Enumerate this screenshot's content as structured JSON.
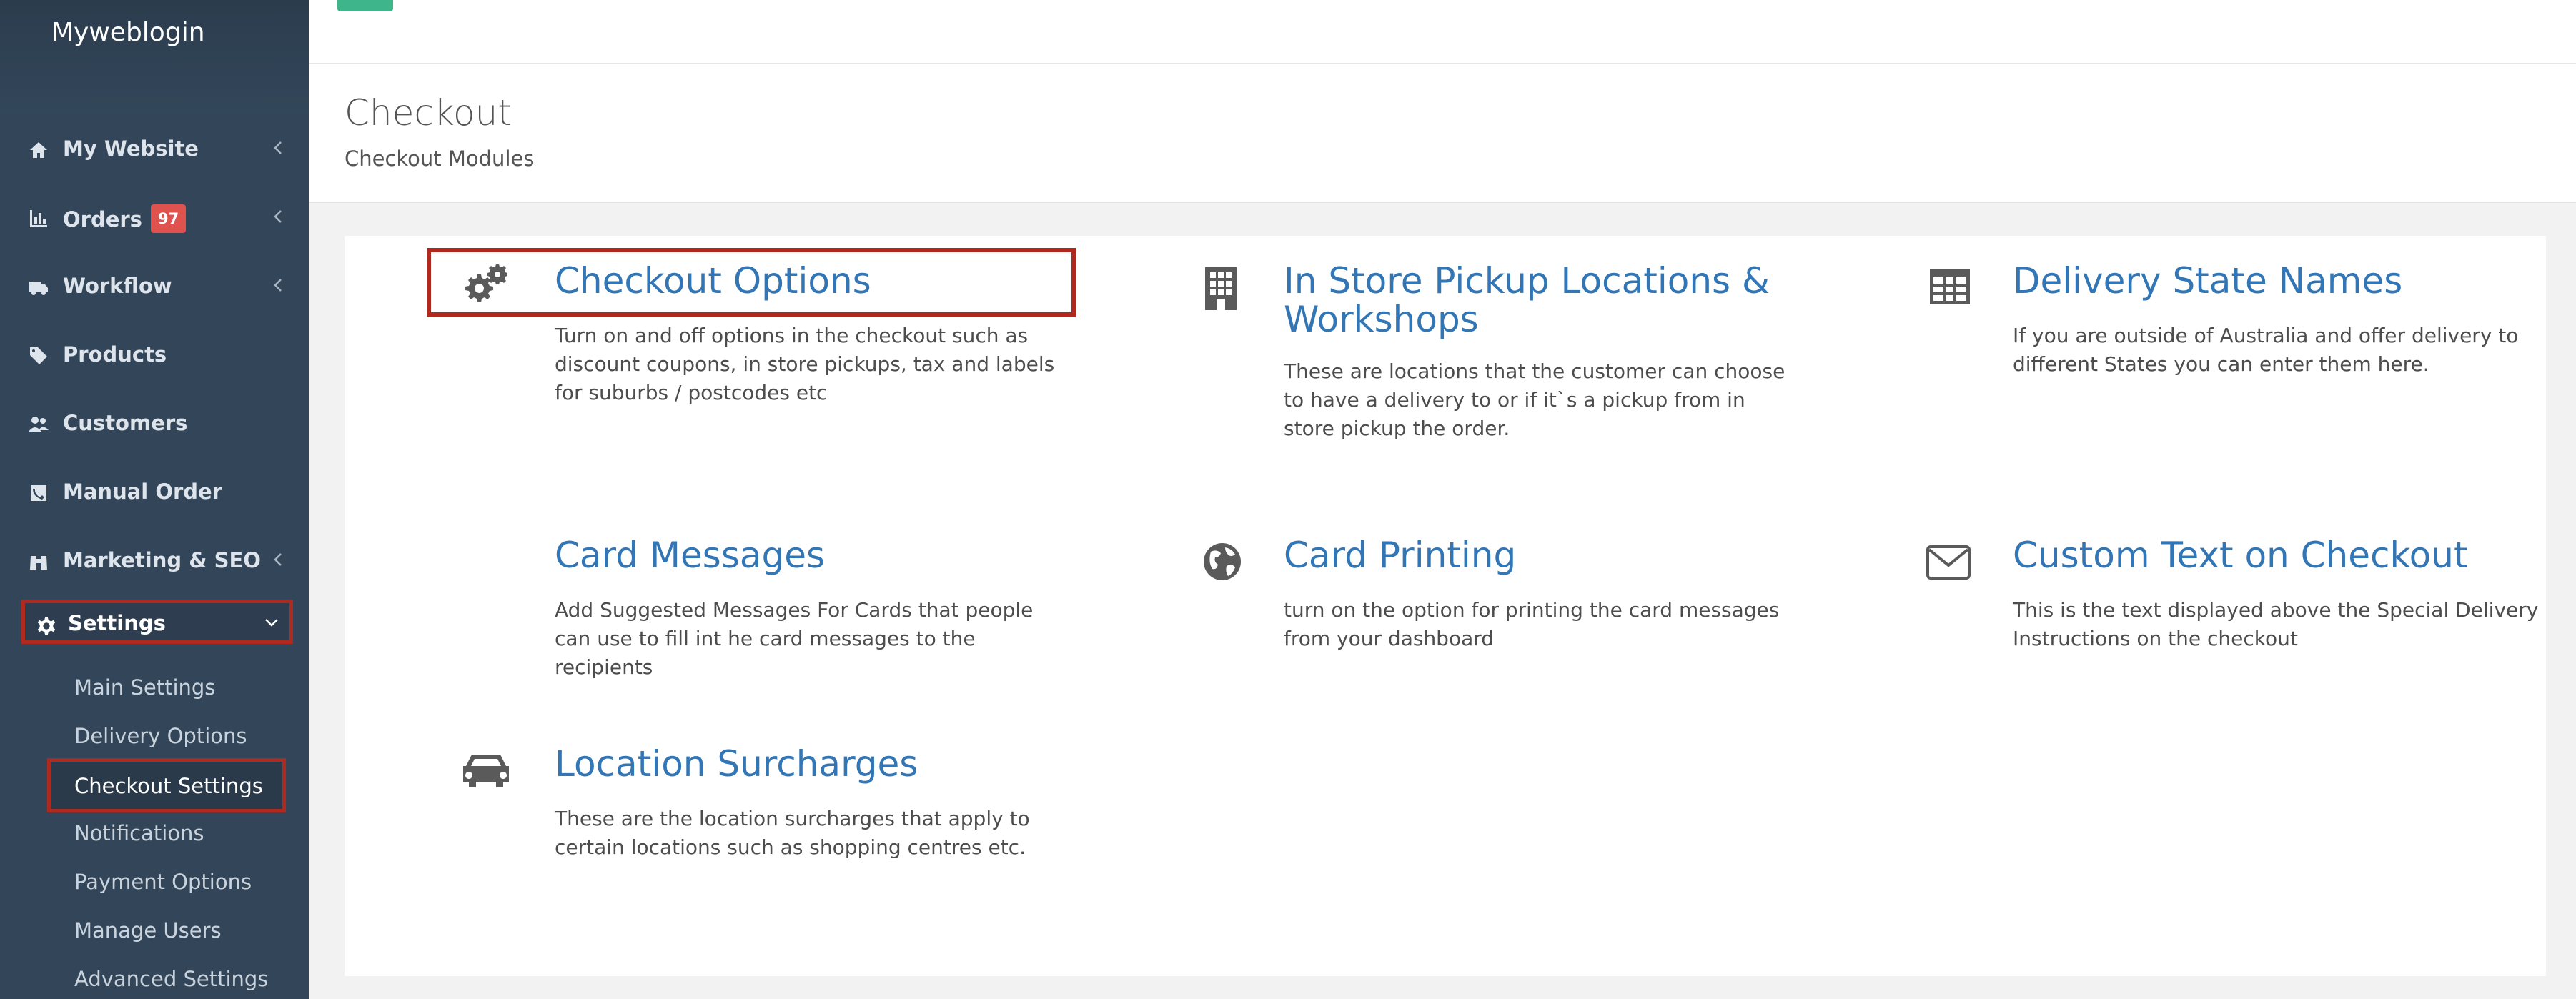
{
  "sidebar": {
    "brand": "Myweblogin",
    "items": [
      {
        "label": "My Website",
        "icon": "home-icon"
      },
      {
        "label": "Orders",
        "icon": "bar-chart-icon",
        "badge": "97"
      },
      {
        "label": "Workflow",
        "icon": "truck-icon"
      },
      {
        "label": "Products",
        "icon": "tags-icon"
      },
      {
        "label": "Customers",
        "icon": "users-icon"
      },
      {
        "label": "Manual Order",
        "icon": "phone-icon"
      },
      {
        "label": "Marketing & SEO",
        "icon": "binoculars-icon"
      },
      {
        "label": "Settings",
        "icon": "gear-icon"
      }
    ],
    "settings_sub": [
      "Main Settings",
      "Delivery Options",
      "Checkout Settings",
      "Notifications",
      "Payment Options",
      "Manage Users",
      "Advanced Settings"
    ]
  },
  "header": {
    "title": "Checkout",
    "subtitle": "Checkout Modules"
  },
  "modules": [
    {
      "title": "Checkout Options",
      "description": "Turn on and off options in the checkout such as discount coupons, in store pickups, tax and labels for suburbs / postcodes etc",
      "icon": "gears-icon"
    },
    {
      "title": "In Store Pickup Locations & Workshops",
      "description": "These are locations that the customer can choose to have a delivery to or if it`s a pickup from in store pickup the order.",
      "icon": "building-icon"
    },
    {
      "title": "Delivery State Names",
      "description": "If you are outside of Australia and offer delivery to different States you can enter them here.",
      "icon": "table-icon"
    },
    {
      "title": "Card Messages",
      "description": "Add Suggested Messages For Cards that people can use to fill int he card messages to the recipients",
      "icon": ""
    },
    {
      "title": "Card Printing",
      "description": "turn on the option for printing the card messages from your dashboard",
      "icon": "globe-icon"
    },
    {
      "title": "Custom Text on Checkout",
      "description": "This is the text displayed above the Special Delivery Instructions on the checkout",
      "icon": "envelope-icon"
    },
    {
      "title": "Location Surcharges",
      "description": "These are the location surcharges that apply to certain locations such as shopping centres etc.",
      "icon": "car-icon"
    }
  ],
  "colors": {
    "sidebar_bg": "#334558",
    "link_blue": "#3276b5",
    "highlight_red": "#b0291f",
    "badge_red": "#e0524e",
    "accent_green": "#3fb58c"
  }
}
